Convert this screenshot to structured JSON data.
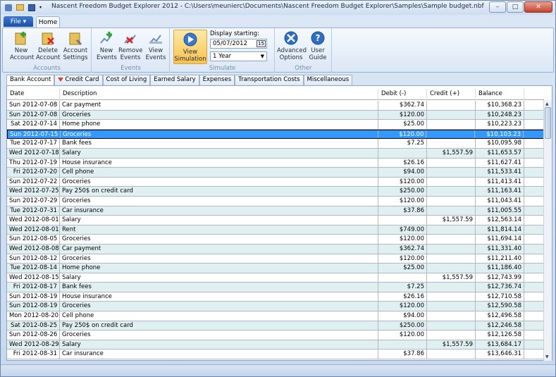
{
  "titlebar": {
    "title": "Nascent Freedom Budget Explorer 2012 - C:\\Users\\meunierc\\Documents\\Nascent Freedom Budget Explorer\\Samples\\Sample budget.nbf",
    "minimize": "–",
    "maximize": "□",
    "close": "✕"
  },
  "menu": {
    "file_label": "File ▾",
    "home_tab": "Home"
  },
  "ribbon": {
    "accounts": {
      "label": "Accounts",
      "new": [
        "New",
        "Account"
      ],
      "delete": [
        "Delete",
        "Account"
      ],
      "settings": [
        "Account",
        "Settings"
      ]
    },
    "events": {
      "label": "Events",
      "new": [
        "New",
        "Events"
      ],
      "remove": [
        "Remove",
        "Events"
      ],
      "view": [
        "View",
        "Events"
      ]
    },
    "simulate": {
      "label": "Simulate",
      "view": [
        "View",
        "Simulation"
      ],
      "display_starting_label": "Display starting:",
      "date_value": "05/07/2012",
      "calendar_text": "15",
      "period_value": "1 Year"
    },
    "other": {
      "label": "Other",
      "advanced": [
        "Advanced",
        "Options"
      ],
      "guide": [
        "User",
        "Guide"
      ]
    }
  },
  "tabs": [
    "Bank Account",
    "Credit Card",
    "Cost of Living",
    "Earned Salary",
    "Expenses",
    "Transportation Costs",
    "Miscellaneous"
  ],
  "grid": {
    "columns": [
      "Date",
      "Description",
      "Debit (-)",
      "Credit (+)",
      "Balance"
    ],
    "selected_index": 3,
    "rows": [
      [
        "Sun 2012-07-08",
        "Car payment",
        "$362.74",
        "",
        "$10,368.23"
      ],
      [
        "Sun 2012-07-08",
        "Groceries",
        "$120.00",
        "",
        "$10,248.23"
      ],
      [
        "Sat 2012-07-14",
        "Home phone",
        "$25.00",
        "",
        "$10,223.23"
      ],
      [
        "Sun 2012-07-15",
        "Groceries",
        "$120.00",
        "",
        "$10,103.23"
      ],
      [
        "Tue 2012-07-17",
        "Bank fees",
        "$7.25",
        "",
        "$10,095.98"
      ],
      [
        "Wed 2012-07-18",
        "Salary",
        "",
        "$1,557.59",
        "$11,653.57"
      ],
      [
        "Thu 2012-07-19",
        "House insurance",
        "$26.16",
        "",
        "$11,627.41"
      ],
      [
        "Fri 2012-07-20",
        "Cell phone",
        "$94.00",
        "",
        "$11,533.41"
      ],
      [
        "Sun 2012-07-22",
        "Groceries",
        "$120.00",
        "",
        "$11,413.41"
      ],
      [
        "Wed 2012-07-25",
        "Pay 250$ on credit card",
        "$250.00",
        "",
        "$11,163.41"
      ],
      [
        "Sun 2012-07-29",
        "Groceries",
        "$120.00",
        "",
        "$11,043.41"
      ],
      [
        "Tue 2012-07-31",
        "Car insurance",
        "$37.86",
        "",
        "$11,005.55"
      ],
      [
        "Wed 2012-08-01",
        "Salary",
        "",
        "$1,557.59",
        "$12,563.14"
      ],
      [
        "Wed 2012-08-01",
        "Rent",
        "$749.00",
        "",
        "$11,814.14"
      ],
      [
        "Sun 2012-08-05",
        "Groceries",
        "$120.00",
        "",
        "$11,694.14"
      ],
      [
        "Wed 2012-08-08",
        "Car payment",
        "$362.74",
        "",
        "$11,331.40"
      ],
      [
        "Sun 2012-08-12",
        "Groceries",
        "$120.00",
        "",
        "$11,211.40"
      ],
      [
        "Tue 2012-08-14",
        "Home phone",
        "$25.00",
        "",
        "$11,186.40"
      ],
      [
        "Wed 2012-08-15",
        "Salary",
        "",
        "$1,557.59",
        "$12,743.99"
      ],
      [
        "Fri 2012-08-17",
        "Bank fees",
        "$7.25",
        "",
        "$12,736.74"
      ],
      [
        "Sun 2012-08-19",
        "House insurance",
        "$26.16",
        "",
        "$12,710.58"
      ],
      [
        "Sun 2012-08-19",
        "Groceries",
        "$120.00",
        "",
        "$12,590.58"
      ],
      [
        "Mon 2012-08-20",
        "Cell phone",
        "$94.00",
        "",
        "$12,496.58"
      ],
      [
        "Sat 2012-08-25",
        "Pay 250$ on credit card",
        "$250.00",
        "",
        "$12,246.58"
      ],
      [
        "Sun 2012-08-26",
        "Groceries",
        "$120.00",
        "",
        "$12,126.58"
      ],
      [
        "Wed 2012-08-29",
        "Salary",
        "",
        "$1,557.59",
        "$13,684.17"
      ],
      [
        "Fri 2012-08-31",
        "Car insurance",
        "$37.86",
        "",
        "$13,646.31"
      ]
    ]
  },
  "colors": {
    "selection": "#3399ff",
    "alt_row": "#e0eff0",
    "active_button": "#f9c24e"
  }
}
